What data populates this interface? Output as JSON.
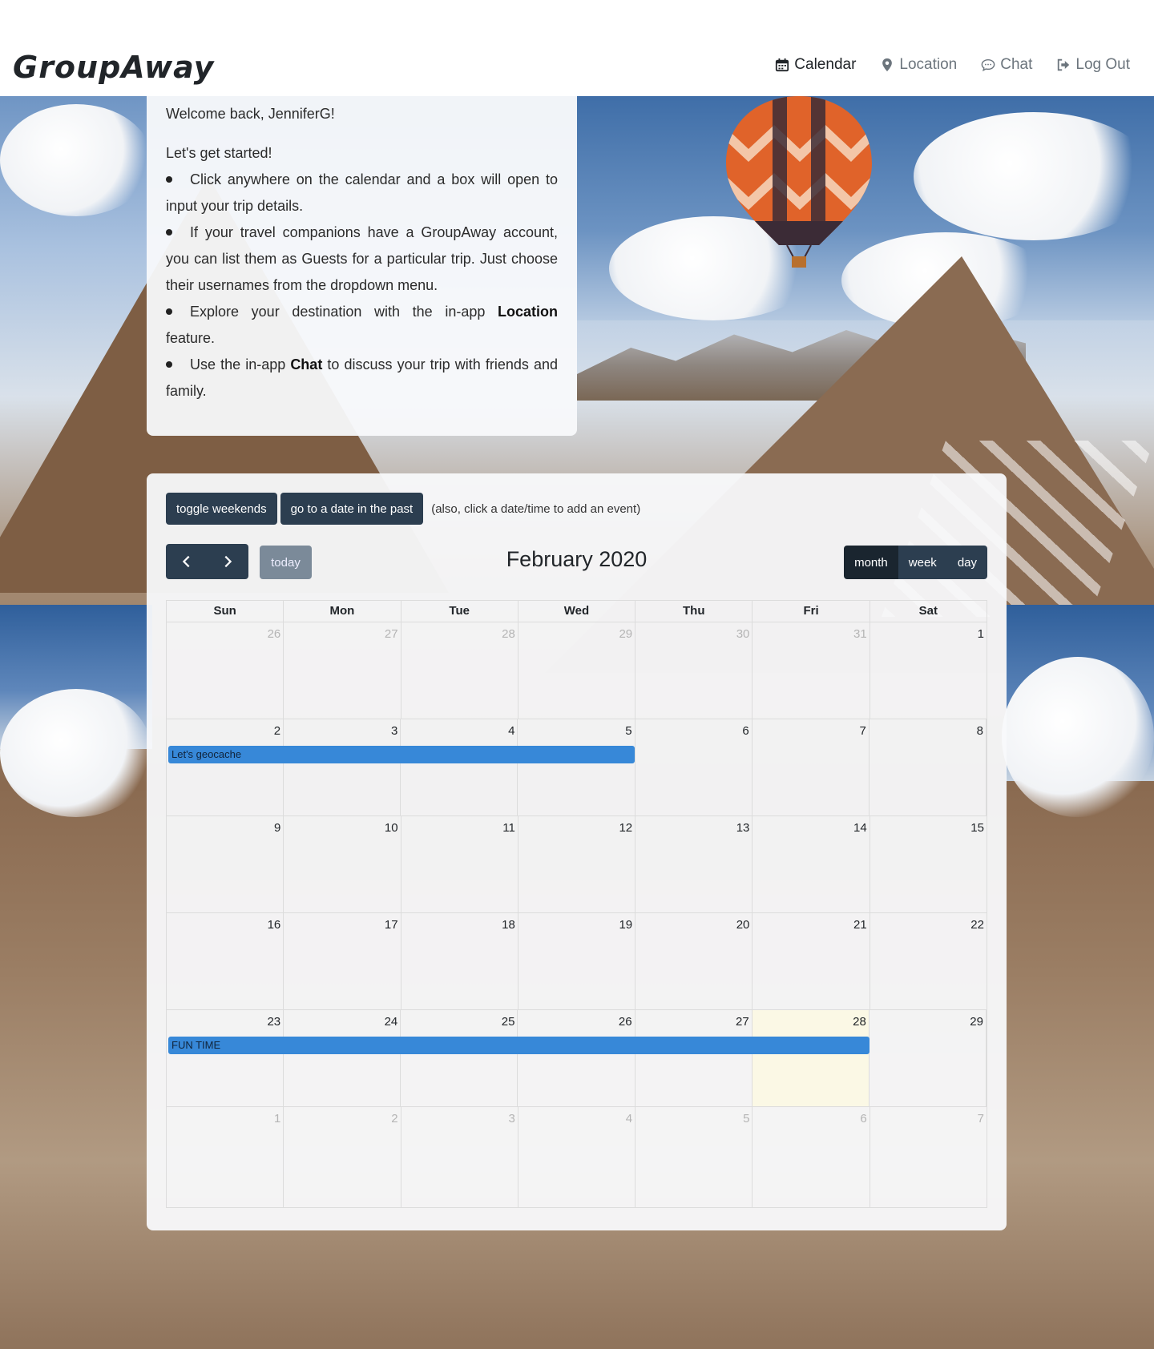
{
  "app": {
    "brand": "GroupAway"
  },
  "nav": {
    "calendar": "Calendar",
    "location": "Location",
    "chat": "Chat",
    "logout": "Log Out"
  },
  "welcome": {
    "greeting": "Welcome back, JenniferG!",
    "lead": "Let's get started!",
    "bullet1": "Click anywhere on the calendar and a box will open to input your trip details.",
    "bullet2": "If your travel companions have a GroupAway account, you can list them as Guests for a particular trip. Just choose their usernames from the dropdown menu.",
    "bullet3_pre": "Explore your destination with the in-app ",
    "bullet3_bold": "Location",
    "bullet3_post": " feature.",
    "bullet4_pre": "Use the in-app ",
    "bullet4_bold": "Chat",
    "bullet4_post": " to discuss your trip with friends and family."
  },
  "toolbar": {
    "toggle_weekends": "toggle weekends",
    "go_past": "go to a date in the past",
    "hint": "(also, click a date/time to add an event)",
    "today": "today",
    "title": "February 2020",
    "views": [
      "month",
      "week",
      "day"
    ]
  },
  "calendar": {
    "weekdays": [
      "Sun",
      "Mon",
      "Tue",
      "Wed",
      "Thu",
      "Fri",
      "Sat"
    ],
    "weeks": [
      [
        {
          "d": "26",
          "o": true
        },
        {
          "d": "27",
          "o": true
        },
        {
          "d": "28",
          "o": true
        },
        {
          "d": "29",
          "o": true
        },
        {
          "d": "30",
          "o": true
        },
        {
          "d": "31",
          "o": true
        },
        {
          "d": "1",
          "o": false
        }
      ],
      [
        {
          "d": "2",
          "o": false
        },
        {
          "d": "3",
          "o": false
        },
        {
          "d": "4",
          "o": false
        },
        {
          "d": "5",
          "o": false
        },
        {
          "d": "6",
          "o": false
        },
        {
          "d": "7",
          "o": false
        },
        {
          "d": "8",
          "o": false
        }
      ],
      [
        {
          "d": "9",
          "o": false
        },
        {
          "d": "10",
          "o": false
        },
        {
          "d": "11",
          "o": false
        },
        {
          "d": "12",
          "o": false
        },
        {
          "d": "13",
          "o": false
        },
        {
          "d": "14",
          "o": false
        },
        {
          "d": "15",
          "o": false
        }
      ],
      [
        {
          "d": "16",
          "o": false
        },
        {
          "d": "17",
          "o": false
        },
        {
          "d": "18",
          "o": false
        },
        {
          "d": "19",
          "o": false
        },
        {
          "d": "20",
          "o": false
        },
        {
          "d": "21",
          "o": false
        },
        {
          "d": "22",
          "o": false
        }
      ],
      [
        {
          "d": "23",
          "o": false
        },
        {
          "d": "24",
          "o": false
        },
        {
          "d": "25",
          "o": false
        },
        {
          "d": "26",
          "o": false
        },
        {
          "d": "27",
          "o": false
        },
        {
          "d": "28",
          "o": false,
          "today": true
        },
        {
          "d": "29",
          "o": false
        }
      ],
      [
        {
          "d": "1",
          "o": true
        },
        {
          "d": "2",
          "o": true
        },
        {
          "d": "3",
          "o": true
        },
        {
          "d": "4",
          "o": true
        },
        {
          "d": "5",
          "o": true
        },
        {
          "d": "6",
          "o": true
        },
        {
          "d": "7",
          "o": true
        }
      ]
    ],
    "events": [
      {
        "title": "Let's geocache",
        "week": 1,
        "start_col": 0,
        "span": 4
      },
      {
        "title": "FUN TIME",
        "week": 4,
        "start_col": 0,
        "span": 6
      }
    ],
    "event_color": "#3788d8",
    "today_color": "#fcf8e3"
  },
  "colors": {
    "button_dark": "#2c3e50",
    "button_active": "#1a252f",
    "today_button": "#7b8a99"
  }
}
